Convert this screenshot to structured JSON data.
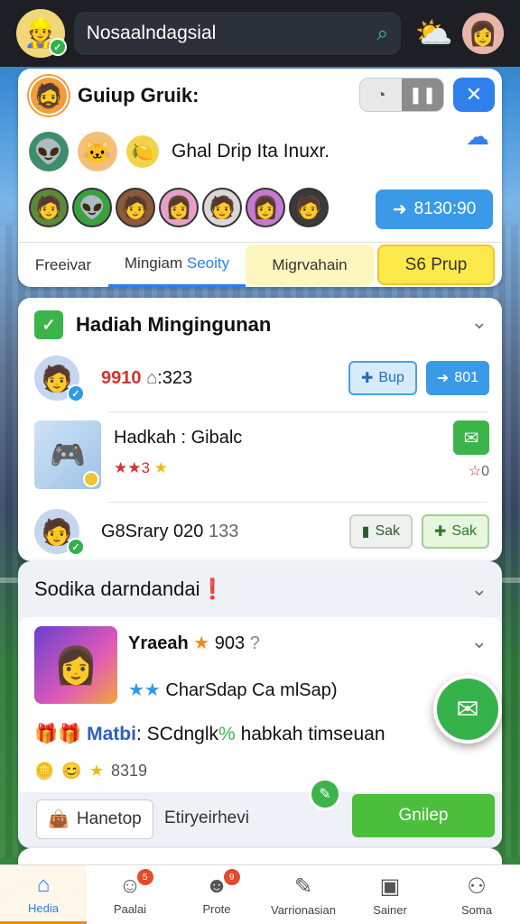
{
  "header": {
    "search_text": "Nosaalndagsial"
  },
  "group_card": {
    "title": "Guiup Gruik:",
    "subtitle": "Ghal Drip Ita Inuxr.",
    "time_button": "8130:90",
    "tabs": [
      {
        "label": "Freeivar"
      },
      {
        "label_a": "Mingiam",
        "label_b": "Seoity"
      },
      {
        "label": "Migrvahain"
      },
      {
        "label": "S6 Prup"
      }
    ]
  },
  "rewards_card": {
    "title": "Hadiah Mingingunan",
    "rows": [
      {
        "value_red": "9910",
        "value_rest": ":323",
        "btn1": "Bup",
        "btn2": "801"
      },
      {
        "title": "Hadkah : Gibalc",
        "stars_red": "★★3",
        "stars_yellow": "★",
        "rating": "0"
      },
      {
        "text": "G8Srary 020",
        "text_muted": "133",
        "btn1": "Sak",
        "btn2": "Sak"
      }
    ]
  },
  "promo_card": {
    "title": "Sodika darndandai",
    "item_title": "Yraeah",
    "item_score": "903",
    "line1": "CharSdap Ca mlSap)",
    "line2_a": "Matbi",
    "line2_b": "SCdnglk",
    "line2_c": "habkah timseuan",
    "points": "8319",
    "shop_button": "Hanetop",
    "action_label": "Etiryeirhevi",
    "green_button": "Gnilep"
  },
  "bottom_nav": [
    {
      "label": "Hedia",
      "badge": ""
    },
    {
      "label": "Paalai",
      "badge": "5"
    },
    {
      "label": "Prote",
      "badge": "9"
    },
    {
      "label": "Varrionasian",
      "badge": ""
    },
    {
      "label": "Sainer",
      "badge": ""
    },
    {
      "label": "Soma",
      "badge": ""
    }
  ]
}
